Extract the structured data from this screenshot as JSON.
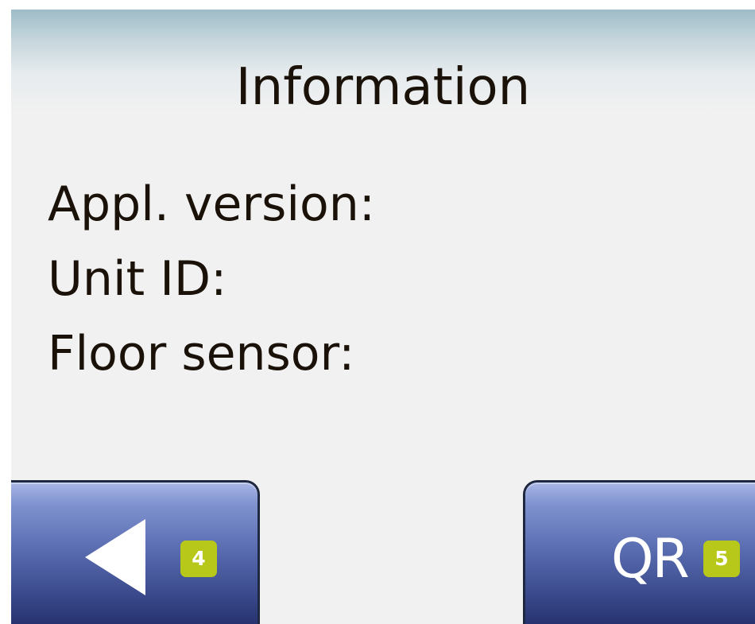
{
  "screen": {
    "title": "Information",
    "info_rows": [
      {
        "label": "Appl. version:"
      },
      {
        "label": "Unit ID:"
      },
      {
        "label": "Floor sensor:"
      }
    ]
  },
  "nav": {
    "back_button": {
      "icon": "back-arrow-icon",
      "badge": "4"
    },
    "qr_button": {
      "label": "QR",
      "badge": "5"
    }
  },
  "colors": {
    "badge": "#b8c81a",
    "button_top": "#a9b6e6",
    "button_bottom": "#1c2660",
    "text": "#1a1208"
  }
}
